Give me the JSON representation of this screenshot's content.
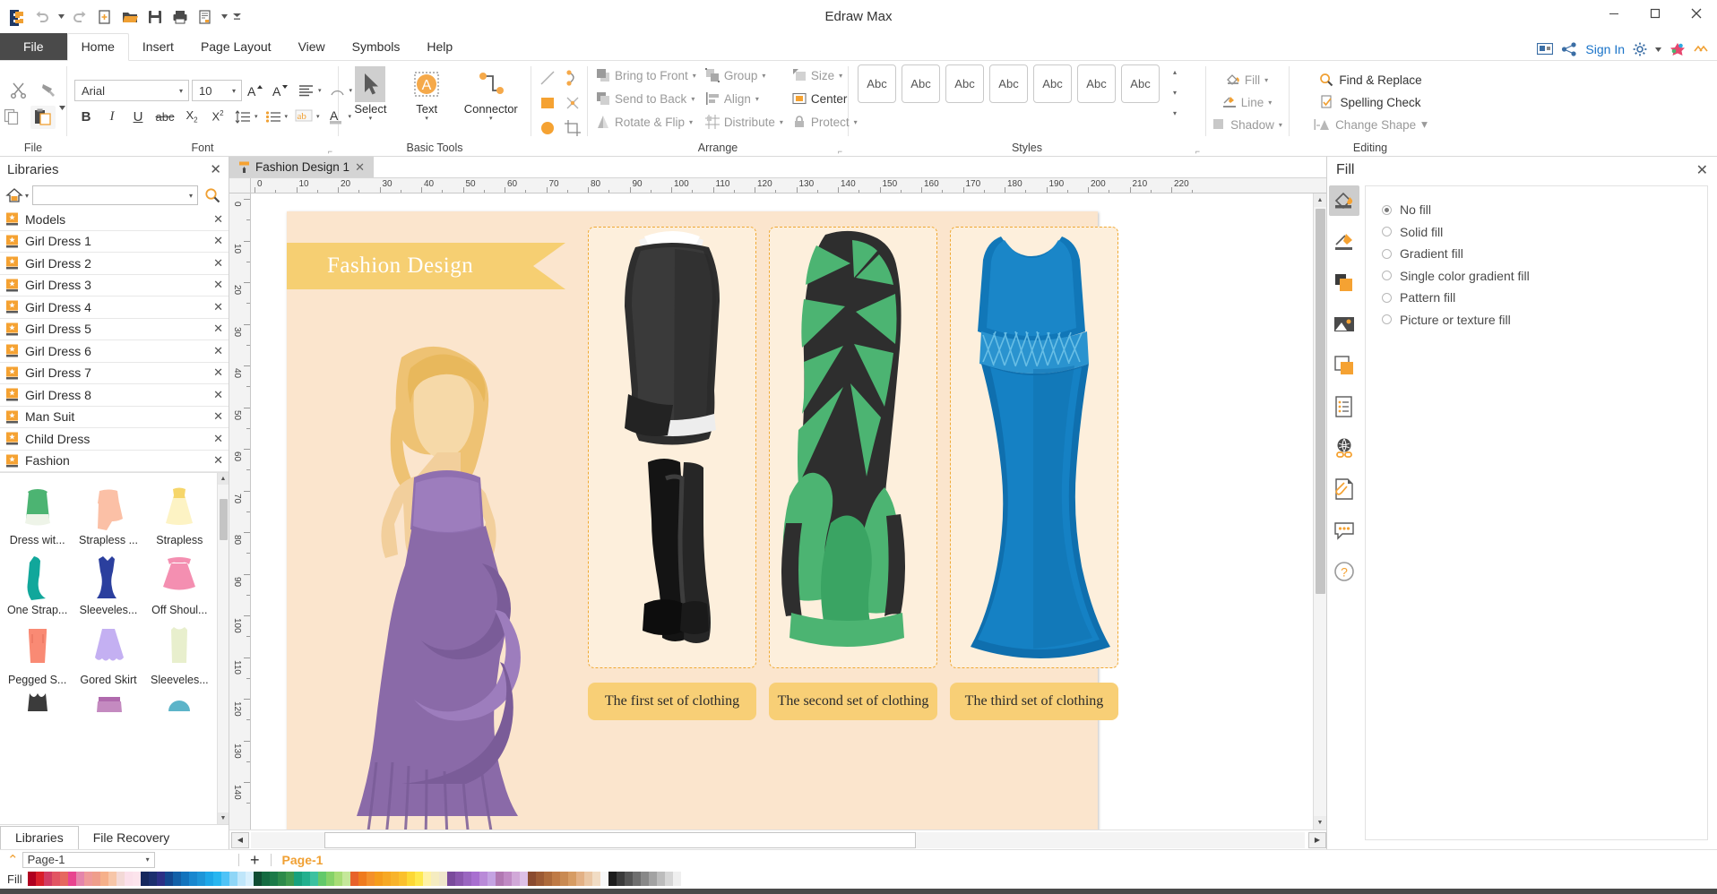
{
  "window": {
    "title": "Edraw Max",
    "minimize": "─",
    "maximize": "❐",
    "close": "✕"
  },
  "quick_access": {
    "items": [
      {
        "name": "app-logo",
        "label": "Edraw"
      },
      {
        "name": "undo-icon",
        "label": "Undo"
      },
      {
        "name": "undo-dropdown",
        "label": "Undo options"
      },
      {
        "name": "redo-icon",
        "label": "Redo"
      },
      {
        "name": "new-icon",
        "label": "New"
      },
      {
        "name": "open-icon",
        "label": "Open"
      },
      {
        "name": "save-icon",
        "label": "Save"
      },
      {
        "name": "print-icon",
        "label": "Print"
      },
      {
        "name": "export-icon",
        "label": "Export"
      },
      {
        "name": "export-dropdown",
        "label": "Export options"
      },
      {
        "name": "customize-qat-icon",
        "label": "Customize Quick Access Toolbar"
      }
    ]
  },
  "menu": {
    "tabs": [
      {
        "label": "File",
        "id": "file"
      },
      {
        "label": "Home",
        "id": "home"
      },
      {
        "label": "Insert",
        "id": "insert"
      },
      {
        "label": "Page Layout",
        "id": "page-layout"
      },
      {
        "label": "View",
        "id": "view"
      },
      {
        "label": "Symbols",
        "id": "symbols"
      },
      {
        "label": "Help",
        "id": "help"
      }
    ],
    "active": "Home",
    "sign_in": "Sign In"
  },
  "ribbon": {
    "groups": [
      {
        "title": "File"
      },
      {
        "title": "Font"
      },
      {
        "title": "Basic Tools"
      },
      {
        "title": "Arrange"
      },
      {
        "title": "Styles"
      },
      {
        "title": "Editing"
      }
    ],
    "file_group": {
      "title": "File",
      "cut": "Cut",
      "format_painter": "Format Painter",
      "copy": "Copy",
      "paste": "Paste"
    },
    "font_group": {
      "title": "Font",
      "font_family": "Arial",
      "font_size": "10",
      "grow_font": "A",
      "shrink_font": "A",
      "bold": "B",
      "italic": "I",
      "underline": "U",
      "strikethrough": "abc",
      "subscript": "X",
      "superscript": "X",
      "line_spacing": "Line Spacing",
      "bullets": "Bullets",
      "text_box": "Text Box",
      "font_color": "A"
    },
    "tools_group": {
      "title": "Basic Tools",
      "select": "Select",
      "text": "Text",
      "connector": "Connector",
      "shapes": [
        "line",
        "curve",
        "rectangle",
        "cross",
        "ellipse",
        "crop"
      ]
    },
    "arrange_group": {
      "title": "Arrange",
      "items": [
        {
          "label": "Bring to Front",
          "icon": "bring-to-front-icon",
          "dropdown": true
        },
        {
          "label": "Send to Back",
          "icon": "send-to-back-icon",
          "dropdown": true
        },
        {
          "label": "Rotate & Flip",
          "icon": "rotate-flip-icon",
          "dropdown": true
        },
        {
          "label": "Group",
          "icon": "group-icon",
          "dropdown": true
        },
        {
          "label": "Align",
          "icon": "align-icon",
          "dropdown": true
        },
        {
          "label": "Distribute",
          "icon": "distribute-icon",
          "dropdown": true
        },
        {
          "label": "Size",
          "icon": "size-icon",
          "dropdown": true
        },
        {
          "label": "Center",
          "icon": "center-icon",
          "dropdown": false
        },
        {
          "label": "Protect",
          "icon": "protect-icon",
          "dropdown": true
        }
      ]
    },
    "styles_group": {
      "title": "Styles",
      "sample": "Abc",
      "count": 7
    },
    "fill_line_group": {
      "fill": "Fill",
      "line": "Line",
      "shadow": "Shadow"
    },
    "editing_group": {
      "title": "Editing",
      "find_replace": "Find & Replace",
      "spelling_check": "Spelling Check",
      "change_shape": "Change Shape"
    }
  },
  "sidebar": {
    "title": "Libraries",
    "search_placeholder": "",
    "search_value": "",
    "libraries": [
      "Models",
      "Girl Dress 1",
      "Girl Dress 2",
      "Girl Dress 3",
      "Girl Dress 4",
      "Girl Dress 5",
      "Girl Dress 6",
      "Girl Dress 7",
      "Girl Dress 8",
      "Man Suit",
      "Child Dress",
      "Fashion"
    ],
    "shapes": [
      {
        "label": "Dress wit...",
        "color": "#4cb472",
        "kind": "dress-short"
      },
      {
        "label": "Strapless ...",
        "color": "#fbc0a6",
        "kind": "strapless-a"
      },
      {
        "label": "Strapless",
        "color": "#fdf3c4",
        "kind": "gown"
      },
      {
        "label": "One Strap...",
        "color": "#11a79b",
        "kind": "mermaid"
      },
      {
        "label": "Sleeveles...",
        "color": "#2b3f9e",
        "kind": "mermaid"
      },
      {
        "label": "Off Shoul...",
        "color": "#f48fb1",
        "kind": "aline"
      },
      {
        "label": "Pegged S...",
        "color": "#f98a74",
        "kind": "pencil-skirt"
      },
      {
        "label": "Gored Skirt",
        "color": "#c4b0f2",
        "kind": "flare-skirt"
      },
      {
        "label": "Sleeveles...",
        "color": "#e8efcd",
        "kind": "tank"
      },
      {
        "label": "",
        "color": "#3b3b3b",
        "kind": "croptop"
      },
      {
        "label": "",
        "color": "#c48ac0",
        "kind": "miniskirt"
      },
      {
        "label": "",
        "color": "#5cb4c9",
        "kind": "cap"
      }
    ],
    "tabs": [
      {
        "label": "Libraries",
        "active": true
      },
      {
        "label": "File Recovery",
        "active": false
      }
    ]
  },
  "document": {
    "tab_label": "Fashion Design 1",
    "ruler_h_labels": [
      "0",
      "10",
      "20",
      "30",
      "40",
      "50",
      "60",
      "70",
      "80",
      "90",
      "100",
      "110",
      "120",
      "130",
      "140",
      "150",
      "160",
      "170",
      "180",
      "190",
      "200",
      "210",
      "220"
    ],
    "ruler_v_labels": [
      "0",
      "10",
      "20",
      "30",
      "40",
      "50",
      "60",
      "70",
      "80",
      "90",
      "100",
      "110",
      "120",
      "130",
      "140"
    ],
    "title_banner": "Fashion Design",
    "captions": [
      "The first set of clothing",
      "The second set of clothing",
      "The third set of clothing"
    ]
  },
  "fill_panel": {
    "title": "Fill",
    "close": "✕",
    "side_icons": [
      {
        "name": "fill-icon",
        "selected": true
      },
      {
        "name": "line-icon",
        "selected": false
      },
      {
        "name": "color-swatch-icon",
        "selected": false
      },
      {
        "name": "picture-icon",
        "selected": false
      },
      {
        "name": "shadow-icon",
        "selected": false
      },
      {
        "name": "document-properties-icon",
        "selected": false
      },
      {
        "name": "hyperlink-icon",
        "selected": false
      },
      {
        "name": "attachment-icon",
        "selected": false
      },
      {
        "name": "comment-icon",
        "selected": false
      },
      {
        "name": "help-icon",
        "selected": false
      }
    ],
    "options": [
      {
        "label": "No fill",
        "selected": true
      },
      {
        "label": "Solid fill",
        "selected": false
      },
      {
        "label": "Gradient fill",
        "selected": false
      },
      {
        "label": "Single color gradient fill",
        "selected": false
      },
      {
        "label": "Pattern fill",
        "selected": false
      },
      {
        "label": "Picture or texture fill",
        "selected": false
      }
    ]
  },
  "status": {
    "page_selector_value": "Page-1",
    "add_page": "+",
    "current_page": "Page-1",
    "fill_label": "Fill",
    "palette": [
      "#b00020",
      "#d91e2a",
      "#d13b63",
      "#e25563",
      "#e6685e",
      "#e8448f",
      "#e585ab",
      "#ef9a9a",
      "#ef9e8b",
      "#f6b08a",
      "#f7c6a8",
      "#f3d9d6",
      "#fbe0ea",
      "#fce4ec",
      "#16285e",
      "#1b2f6e",
      "#2b2f85",
      "#13478f",
      "#1260a8",
      "#1273bd",
      "#1887cf",
      "#1d95d8",
      "#1ea7e8",
      "#28b6f0",
      "#4fc3f7",
      "#8fd6f7",
      "#bfe6fa",
      "#d8effc",
      "#0e4d33",
      "#146b41",
      "#1b7a48",
      "#2c8a4a",
      "#3f9a4e",
      "#17a17d",
      "#22b08e",
      "#3cc1a0",
      "#63c96a",
      "#86d268",
      "#a8dd76",
      "#c5e79a",
      "#e8622a",
      "#ef7b1e",
      "#f4902a",
      "#f59c1c",
      "#f7a823",
      "#f8b32b",
      "#fbc02d",
      "#fdd835",
      "#ffe94d",
      "#fff2a6",
      "#f5ecc0",
      "#efe6cc",
      "#7a4b9c",
      "#8a57ad",
      "#9a66c0",
      "#a86fd0",
      "#b98ad8",
      "#c4a3e2",
      "#b178b2",
      "#c08ac4",
      "#d1a8d8",
      "#ddc0e6",
      "#8a4b2f",
      "#9c5a34",
      "#ad6a3b",
      "#bf7a45",
      "#c98a52",
      "#d79c63",
      "#e3b185",
      "#eac7a5",
      "#f1dcc4",
      "#f7f7f7",
      "#1c1c1c",
      "#3a3a3a",
      "#545454",
      "#6e6e6e",
      "#888888",
      "#a2a2a2",
      "#bcbcbc",
      "#d6d6d6",
      "#efefef"
    ]
  }
}
